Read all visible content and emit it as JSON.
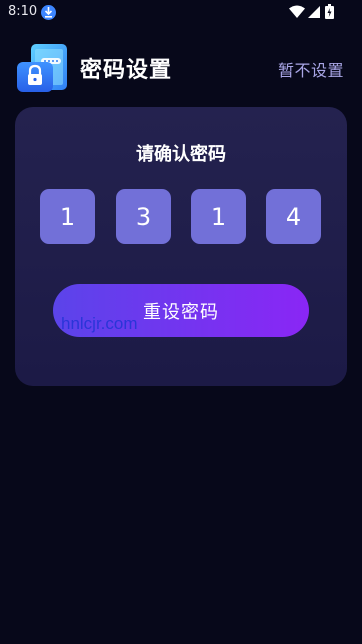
{
  "status_bar": {
    "time": "8:10",
    "icons": [
      "download-icon",
      "wifi-icon",
      "signal-icon",
      "battery-icon"
    ]
  },
  "header": {
    "logo": "lock-phone-icon",
    "title": "密码设置",
    "skip_label": "暂不设置"
  },
  "card": {
    "title": "请确认密码",
    "digits": [
      "1",
      "3",
      "1",
      "4"
    ],
    "reset_button_label": "重设密码",
    "watermark": "hnlcjr.com"
  },
  "colors": {
    "background": "#07081a",
    "card": "#24224f",
    "digit_box": "#7270d8",
    "button_gradient_start": "#5b44ea",
    "button_gradient_end": "#8a26f5",
    "skip_text": "#a9a6e6"
  }
}
